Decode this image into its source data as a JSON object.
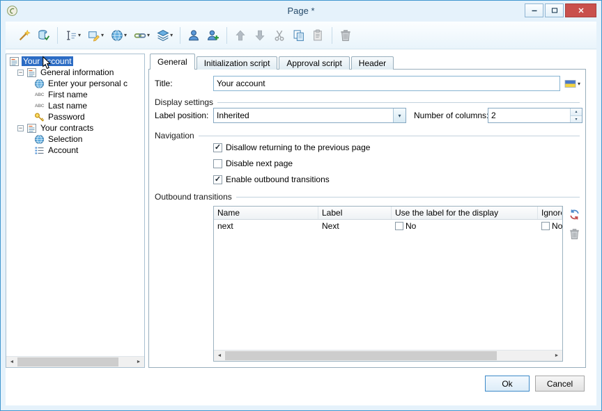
{
  "window": {
    "title": "Page *"
  },
  "toolbar": {
    "items": [
      {
        "name": "edit-wizard",
        "icon": "magic-wand-icon"
      },
      {
        "name": "check-database",
        "icon": "database-check-icon"
      },
      {
        "sep": true
      },
      {
        "name": "insert-field",
        "icon": "insert-field-icon",
        "dropdown": true
      },
      {
        "name": "add-control",
        "icon": "add-control-icon",
        "dropdown": true
      },
      {
        "name": "add-page",
        "icon": "globe-icon",
        "dropdown": true
      },
      {
        "name": "add-link",
        "icon": "link-icon",
        "dropdown": true
      },
      {
        "name": "add-group",
        "icon": "layers-icon",
        "dropdown": true
      },
      {
        "sep": true
      },
      {
        "name": "user",
        "icon": "user-icon"
      },
      {
        "name": "add-user",
        "icon": "user-add-icon"
      },
      {
        "sep": true
      },
      {
        "name": "move-up",
        "icon": "arrow-up-icon",
        "disabled": true
      },
      {
        "name": "move-down",
        "icon": "arrow-down-icon",
        "disabled": true
      },
      {
        "name": "cut",
        "icon": "cut-icon",
        "disabled": true
      },
      {
        "name": "copy",
        "icon": "copy-icon"
      },
      {
        "name": "paste",
        "icon": "paste-icon",
        "disabled": true
      },
      {
        "sep": true
      },
      {
        "name": "delete",
        "icon": "trash-icon",
        "disabled": true
      }
    ]
  },
  "tree": {
    "items": [
      {
        "label": "Your account",
        "level": 0,
        "icon": "form-icon",
        "selected": true
      },
      {
        "label": "General information",
        "level": 1,
        "icon": "form-icon",
        "expander": true
      },
      {
        "label": "Enter your personal c",
        "level": 2,
        "icon": "globe-icon"
      },
      {
        "label": "First name",
        "level": 2,
        "icon": "abc-icon"
      },
      {
        "label": "Last name",
        "level": 2,
        "icon": "abc-icon"
      },
      {
        "label": "Password",
        "level": 2,
        "icon": "key-icon"
      },
      {
        "label": "Your contracts",
        "level": 1,
        "icon": "form-icon",
        "expander": true
      },
      {
        "label": "Selection",
        "level": 2,
        "icon": "globe-icon"
      },
      {
        "label": "Account",
        "level": 2,
        "icon": "list-icon"
      }
    ]
  },
  "tabs": [
    {
      "label": "General",
      "active": true
    },
    {
      "label": "Initialization script"
    },
    {
      "label": "Approval script"
    },
    {
      "label": "Header"
    }
  ],
  "form": {
    "title": {
      "label": "Title:",
      "value": "Your account",
      "action_icon": "localization-icon"
    },
    "display_settings": {
      "legend": "Display settings",
      "label_position": {
        "label": "Label position:",
        "value": "Inherited"
      },
      "number_of_columns": {
        "label": "Number of columns:",
        "value": "2"
      }
    },
    "navigation": {
      "legend": "Navigation",
      "options": [
        {
          "label": "Disallow returning to the previous page",
          "checked": true
        },
        {
          "label": "Disable next page",
          "checked": false
        },
        {
          "label": "Enable outbound transitions",
          "checked": true
        }
      ]
    },
    "outbound_transitions": {
      "legend": "Outbound transitions",
      "columns": [
        "Name",
        "Label",
        "Use the label for the display",
        "Ignore"
      ],
      "rows": [
        {
          "name": "next",
          "label": "Next",
          "use_label": {
            "checked": false,
            "text": "No"
          },
          "ignore": {
            "checked": false,
            "text": "No"
          }
        }
      ],
      "actions": [
        {
          "name": "refresh-transitions",
          "icon": "refresh-icon"
        },
        {
          "name": "delete-transition",
          "icon": "trash-icon"
        }
      ]
    }
  },
  "footer": {
    "ok_label": "Ok",
    "cancel_label": "Cancel"
  }
}
